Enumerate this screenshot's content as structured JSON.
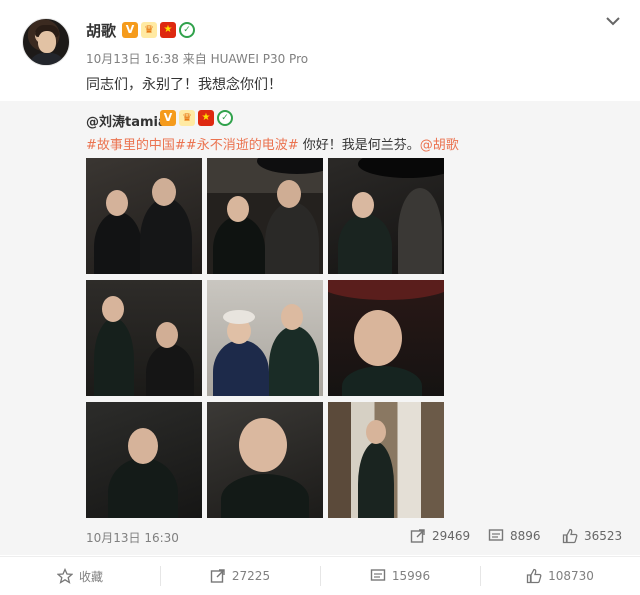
{
  "post": {
    "author": "胡歌",
    "meta": "10月13日 16:38 来自 HUAWEI P30 Pro",
    "text": "同志们，永别了！我想念你们！"
  },
  "repost": {
    "author": "@刘涛tamia",
    "tags": [
      "#故事里的中国#",
      "#永不消逝的电波#"
    ],
    "text_rest": " 你好！我是何兰芬。",
    "mention": "@胡歌",
    "time": "10月13日 16:30",
    "forwards": "29469",
    "comments": "8896",
    "likes": "36523",
    "photos": [
      {
        "label": "couple-portrait"
      },
      {
        "label": "umbrella-couple"
      },
      {
        "label": "umbrella-side"
      },
      {
        "label": "poster-couple"
      },
      {
        "label": "two-women"
      },
      {
        "label": "red-umbrella-closeup"
      },
      {
        "label": "qipao-portrait"
      },
      {
        "label": "qipao-closeup"
      },
      {
        "label": "wardrobe-scene"
      }
    ]
  },
  "actions": {
    "favorite": "收藏",
    "forward": "27225",
    "comment": "15996",
    "like": "108730"
  },
  "colors": {
    "link": "#eb7350",
    "gray_text": "#808080",
    "repost_bg": "#f5f5f5"
  }
}
